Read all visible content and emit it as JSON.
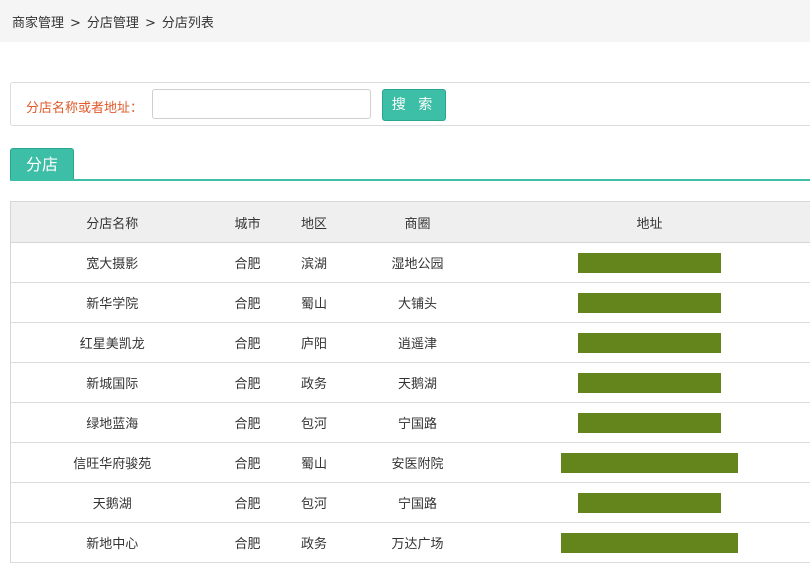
{
  "breadcrumb": {
    "items": [
      "商家管理",
      "分店管理",
      "分店列表"
    ],
    "separator": ">"
  },
  "search": {
    "label": "分店名称或者地址：",
    "value": "",
    "placeholder": "",
    "button_label": "搜 索"
  },
  "tab": {
    "label": "分店"
  },
  "table": {
    "headers": {
      "name": "分店名称",
      "city": "城市",
      "district": "地区",
      "area": "商圈",
      "address": "地址"
    },
    "rows": [
      {
        "name": "宽大摄影",
        "city": "合肥",
        "district": "滨湖",
        "area": "湿地公园",
        "address_redacted": "short"
      },
      {
        "name": "新华学院",
        "city": "合肥",
        "district": "蜀山",
        "area": "大铺头",
        "address_redacted": "short"
      },
      {
        "name": "红星美凯龙",
        "city": "合肥",
        "district": "庐阳",
        "area": "逍遥津",
        "address_redacted": "short"
      },
      {
        "name": "新城国际",
        "city": "合肥",
        "district": "政务",
        "area": "天鹅湖",
        "address_redacted": "short"
      },
      {
        "name": "绿地蓝海",
        "city": "合肥",
        "district": "包河",
        "area": "宁国路",
        "address_redacted": "short"
      },
      {
        "name": "信旺华府骏苑",
        "city": "合肥",
        "district": "蜀山",
        "area": "安医附院",
        "address_redacted": "long"
      },
      {
        "name": "天鹅湖",
        "city": "合肥",
        "district": "包河",
        "area": "宁国路",
        "address_redacted": "short"
      },
      {
        "name": "新地中心",
        "city": "合肥",
        "district": "政务",
        "area": "万达广场",
        "address_redacted": "long"
      }
    ]
  },
  "colors": {
    "accent": "#3dbea6",
    "label_orange": "#e05a2b",
    "redaction": "#63851c",
    "header_bg": "#efefef",
    "topbar_bg": "#f5f5f5"
  }
}
